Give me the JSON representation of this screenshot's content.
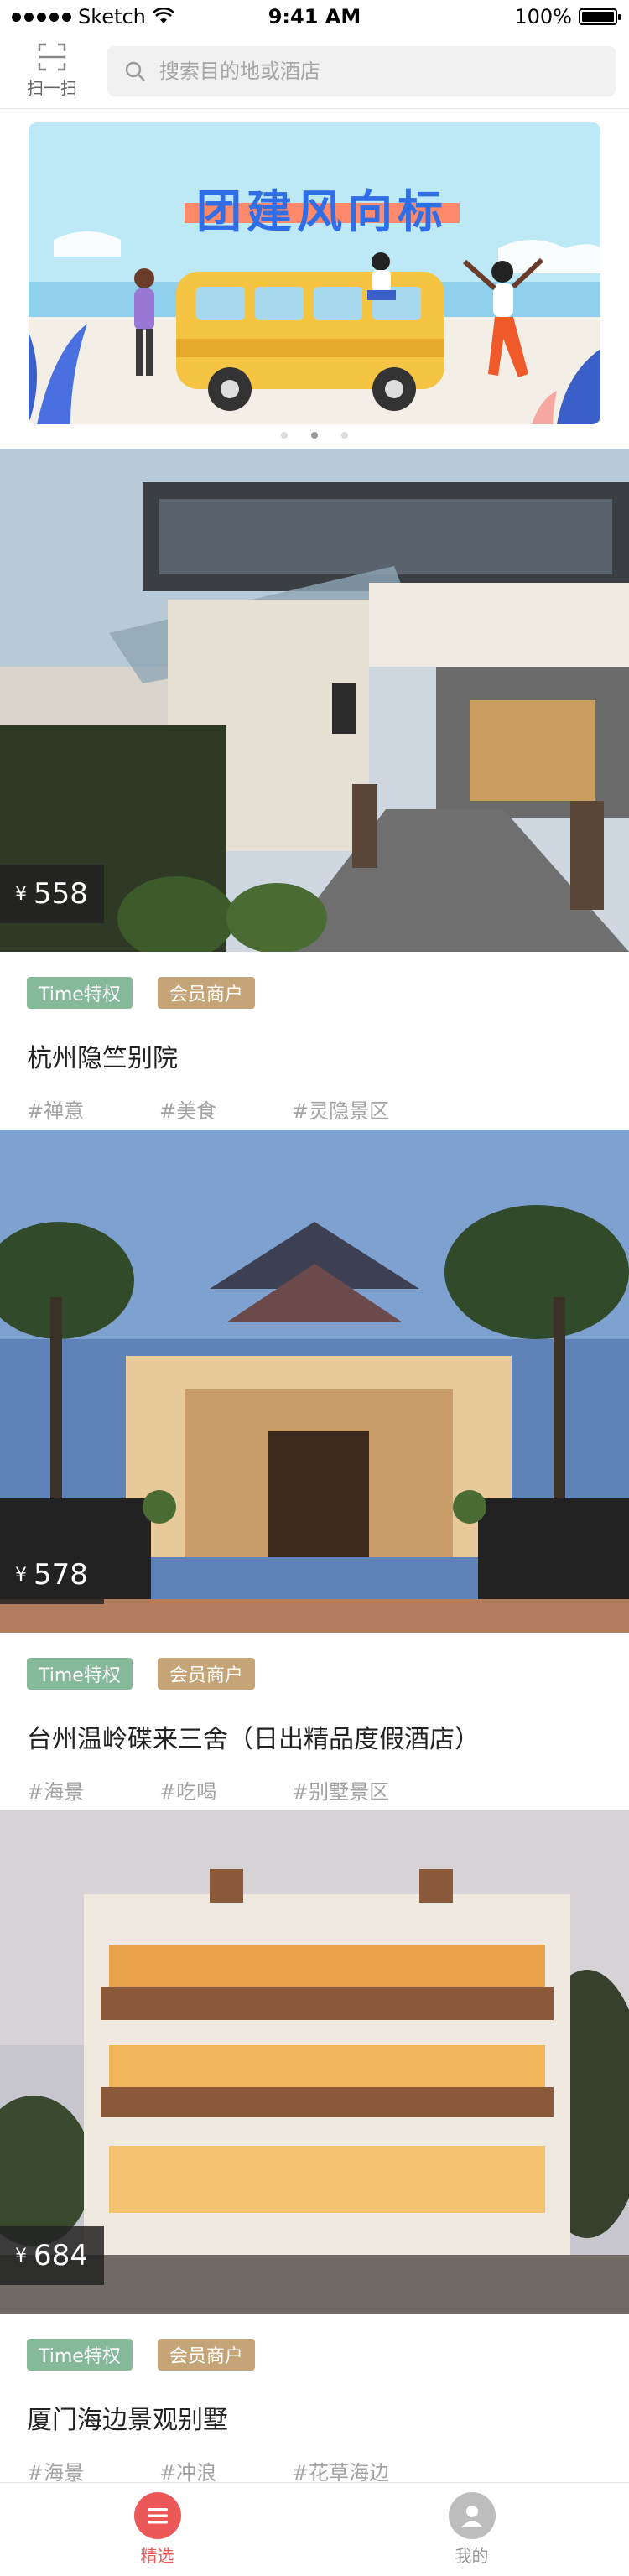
{
  "status_bar": {
    "carrier": "Sketch",
    "time": "9:41 AM",
    "battery": "100%",
    "battery_level": 1.0
  },
  "header": {
    "scan_label": "扫一扫",
    "search_placeholder": "搜索目的地或酒店"
  },
  "banner": {
    "title": "团建风向标",
    "slide_count": 3,
    "active_slide": 1
  },
  "cards": [
    {
      "price_currency": "¥",
      "price": "558",
      "tags": [
        "Time特权",
        "会员商户"
      ],
      "title": "杭州隐竺别院",
      "hashtags": [
        "#禅意",
        "#美食",
        "#灵隐景区"
      ]
    },
    {
      "price_currency": "¥",
      "price": "578",
      "tags": [
        "Time特权",
        "会员商户"
      ],
      "title": "台州温岭碟来三舍（日出精品度假酒店）",
      "hashtags": [
        "#海景",
        "#吃喝",
        "#别墅景区"
      ]
    },
    {
      "price_currency": "¥",
      "price": "684",
      "tags": [
        "Time特权",
        "会员商户"
      ],
      "title": "厦门海边景观别墅",
      "hashtags": [
        "#海景",
        "#冲浪",
        "#花草海边"
      ]
    }
  ],
  "tabbar": {
    "tabs": [
      {
        "label": "精选",
        "active": true
      },
      {
        "label": "我的",
        "active": false
      }
    ]
  },
  "colors": {
    "accent_red": "#ec5757",
    "tag_green": "#86b89a",
    "tag_gold": "#c5a577"
  }
}
